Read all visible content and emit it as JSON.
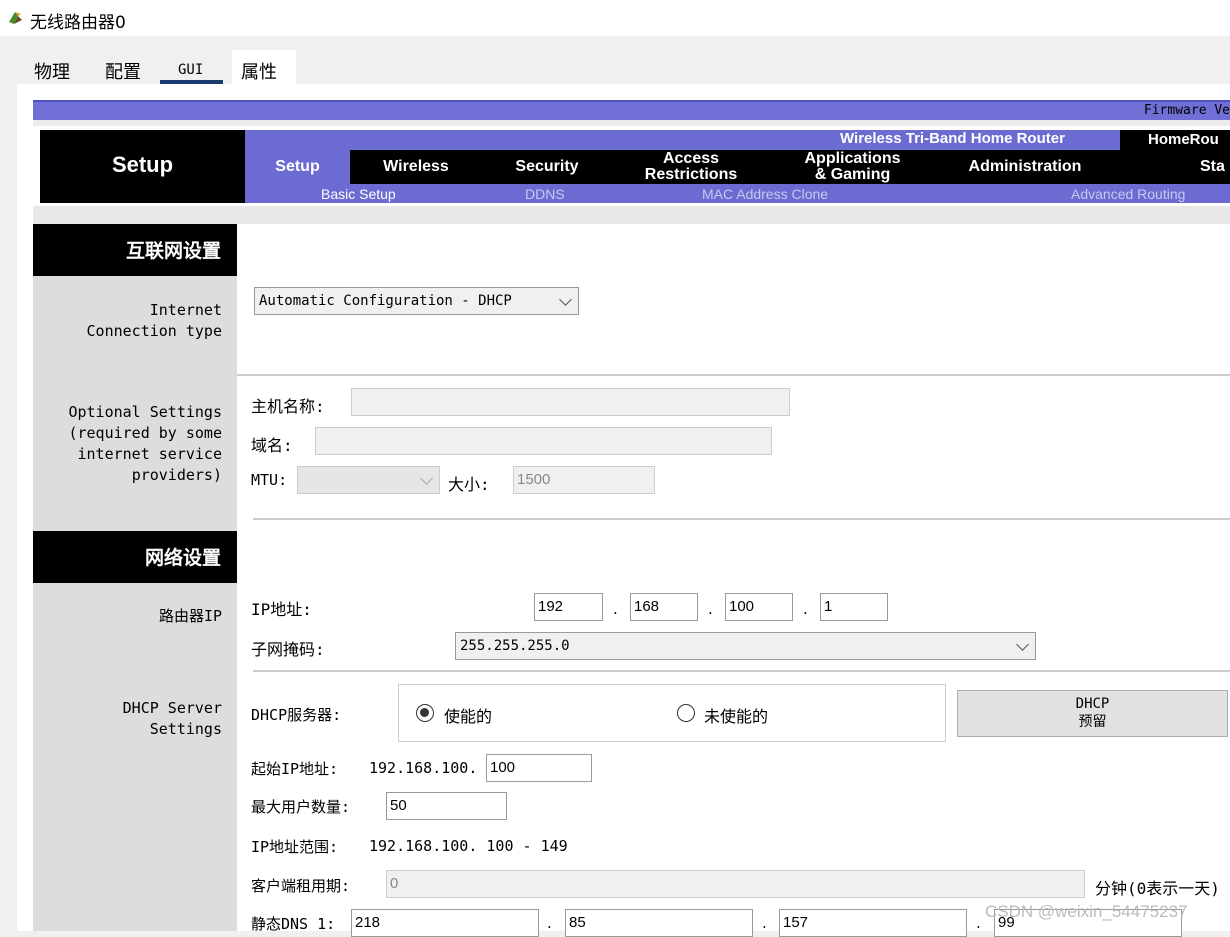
{
  "window": {
    "title": "无线路由器0"
  },
  "tabs": [
    "物理",
    "配置",
    "GUI",
    "属性"
  ],
  "firmware_text": "Firmware Ve",
  "header": {
    "section_title": "Setup",
    "product_name": "Wireless Tri-Band Home Router",
    "model": "HomeRou",
    "nav": [
      {
        "label": "Setup",
        "active": true
      },
      {
        "label": "Wireless"
      },
      {
        "label": "Security"
      },
      {
        "label": "Access\nRestrictions"
      },
      {
        "label": "Applications\n& Gaming"
      },
      {
        "label": "Administration"
      },
      {
        "label": "Sta"
      }
    ],
    "subnav": [
      {
        "label": "Basic Setup",
        "active": true
      },
      {
        "label": "DDNS"
      },
      {
        "label": "MAC Address Clone"
      },
      {
        "label": "Advanced Routing"
      }
    ]
  },
  "internet": {
    "heading": "互联网设置",
    "conn_label": "Internet\nConnection type",
    "conn_value": "Automatic Configuration - DHCP",
    "optional_label": "Optional Settings\n(required by some\ninternet service\nproviders)",
    "hostname_label": "主机名称:",
    "hostname_value": "",
    "domain_label": "域名:",
    "domain_value": "",
    "mtu_label": "MTU:",
    "mtu_value": "",
    "size_label": "大小:",
    "size_value": "1500"
  },
  "network": {
    "heading": "网络设置",
    "router_ip_label": "路由器IP",
    "ip_label": "IP地址:",
    "ip": [
      "192",
      "168",
      "100",
      "1"
    ],
    "mask_label": "子网掩码:",
    "mask_value": "255.255.255.0",
    "dhcp_section_label": "DHCP Server\nSettings",
    "dhcp_label": "DHCP服务器:",
    "enabled_label": "使能的",
    "disabled_label": "未使能的",
    "dhcp_enabled": true,
    "reservation_label": "DHCP\n预留",
    "start_ip_label": "起始IP地址:",
    "start_ip_prefix": "192.168.100.",
    "start_ip_value": "100",
    "max_users_label": "最大用户数量:",
    "max_users_value": "50",
    "range_label": "IP地址范围:",
    "range_value": "192.168.100. 100 - 149",
    "lease_label": "客户端租用期:",
    "lease_value": "0",
    "lease_suffix": "分钟(0表示一天)",
    "dns1_label": "静态DNS 1:",
    "dns1": [
      "218",
      "85",
      "157",
      "99"
    ]
  },
  "watermark": "CSDN @weixin_54475237"
}
